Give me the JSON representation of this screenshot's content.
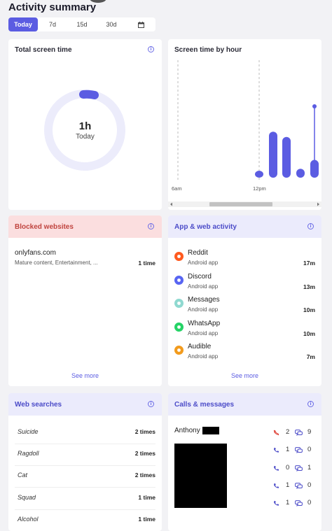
{
  "page": {
    "title": "Activity summary"
  },
  "tabs": [
    {
      "label": "Today",
      "active": true
    },
    {
      "label": "7d"
    },
    {
      "label": "15d"
    },
    {
      "label": "30d"
    },
    {
      "icon": "calendar-icon"
    }
  ],
  "total_screen_time": {
    "title": "Total screen time",
    "value": "1h",
    "label": "Today",
    "ring_fill_fraction": 0.07
  },
  "screen_time_by_hour": {
    "title": "Screen time by hour",
    "x_labels": [
      "6am",
      "12pm"
    ]
  },
  "chart_data": {
    "type": "bar",
    "categories": [
      "",
      "",
      "",
      "",
      "",
      ""
    ],
    "values": [
      0.08,
      0.62,
      0.55,
      0.12,
      0.24,
      1.0
    ],
    "title": "Screen time by hour",
    "xlabel": "",
    "ylabel": "",
    "grid": false
  },
  "blocked_websites": {
    "title": "Blocked websites",
    "items": [
      {
        "site": "onlyfans.com",
        "category": "Mature content, Entertainment, ...",
        "time": "1 time"
      }
    ],
    "see_more": "See more"
  },
  "app_activity": {
    "title": "App & web activity",
    "items": [
      {
        "name": "Reddit",
        "platform": "Android app",
        "duration": "17m",
        "icon": "reddit-icon",
        "color": "#ff5a1f"
      },
      {
        "name": "Discord",
        "platform": "Android app",
        "duration": "13m",
        "icon": "discord-icon",
        "color": "#5865f2"
      },
      {
        "name": "Messages",
        "platform": "Android app",
        "duration": "10m",
        "icon": "messages-icon",
        "color": "#8fd9d0"
      },
      {
        "name": "WhatsApp",
        "platform": "Android app",
        "duration": "10m",
        "icon": "whatsapp-icon",
        "color": "#25d366"
      },
      {
        "name": "Audible",
        "platform": "Android app",
        "duration": "7m",
        "icon": "audible-icon",
        "color": "#f29b1d"
      }
    ],
    "see_more": "See more"
  },
  "web_searches": {
    "title": "Web searches",
    "items": [
      {
        "term": "Suicide",
        "count": "2 times"
      },
      {
        "term": "Ragdoll",
        "count": "2 times"
      },
      {
        "term": "Cat",
        "count": "2 times"
      },
      {
        "term": "Squad",
        "count": "1 time"
      },
      {
        "term": "Alcohol",
        "count": "1 time"
      }
    ]
  },
  "calls_messages": {
    "title": "Calls & messages",
    "contact": "Anthony",
    "rows": [
      {
        "calls": "2",
        "messages": "9",
        "missed": true
      },
      {
        "calls": "1",
        "messages": "0"
      },
      {
        "calls": "0",
        "messages": "1"
      },
      {
        "calls": "1",
        "messages": "0"
      },
      {
        "calls": "1",
        "messages": "0"
      }
    ]
  },
  "colors": {
    "accent": "#5b5ce2",
    "ring_track": "#ececfb",
    "blocked_header": "#fbdedf",
    "section_header": "#ebebfc"
  }
}
